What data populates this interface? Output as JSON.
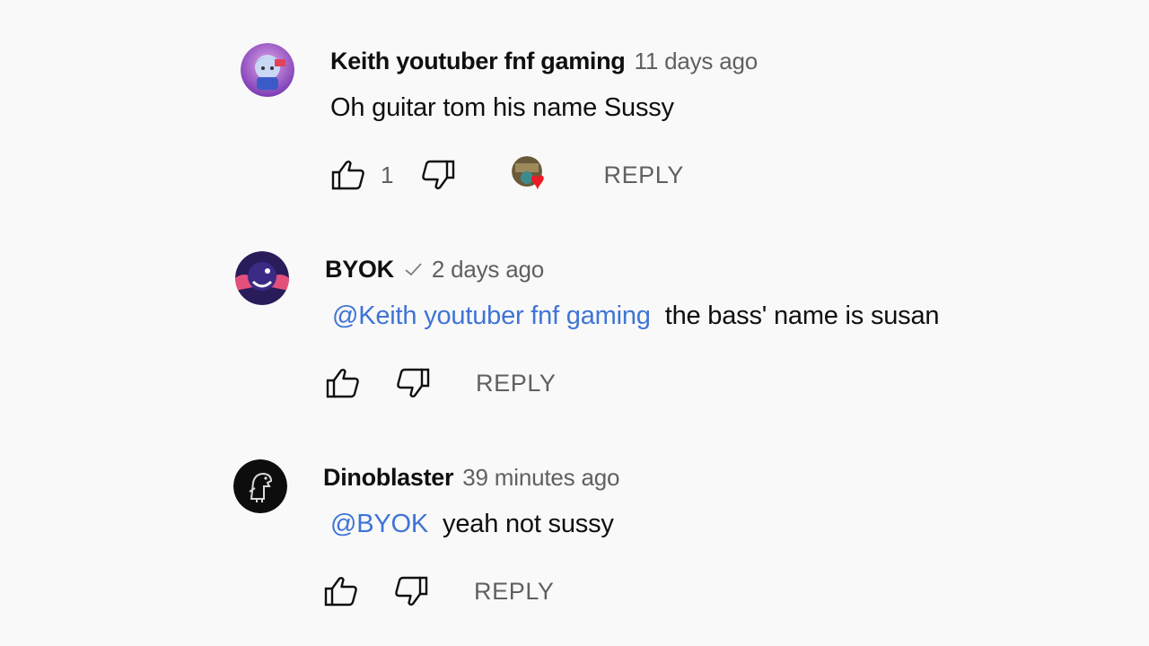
{
  "comments": [
    {
      "author": "Keith youtuber fnf gaming",
      "time": "11 days ago",
      "mention": "",
      "text": "Oh guitar tom his name Sussy",
      "like_count": "1",
      "hearted": true,
      "reply_label": "REPLY",
      "avatar_icon": "anime-character-avatar-icon",
      "verified": false
    },
    {
      "author": "BYOK",
      "time": "2 days ago",
      "mention": "@Keith youtuber fnf gaming",
      "text": "the bass' name is susan",
      "like_count": "",
      "hearted": false,
      "reply_label": "REPLY",
      "avatar_icon": "dark-character-avatar-icon",
      "verified": true
    },
    {
      "author": "Dinoblaster",
      "time": "39 minutes ago",
      "mention": "@BYOK",
      "text": "yeah not sussy",
      "like_count": "",
      "hearted": false,
      "reply_label": "REPLY",
      "avatar_icon": "dino-avatar-icon",
      "verified": false
    }
  ],
  "colors": {
    "background": "#f9f9f9",
    "mention": "#3f74d6",
    "meta": "#606060",
    "heart": "#ee1b24"
  }
}
